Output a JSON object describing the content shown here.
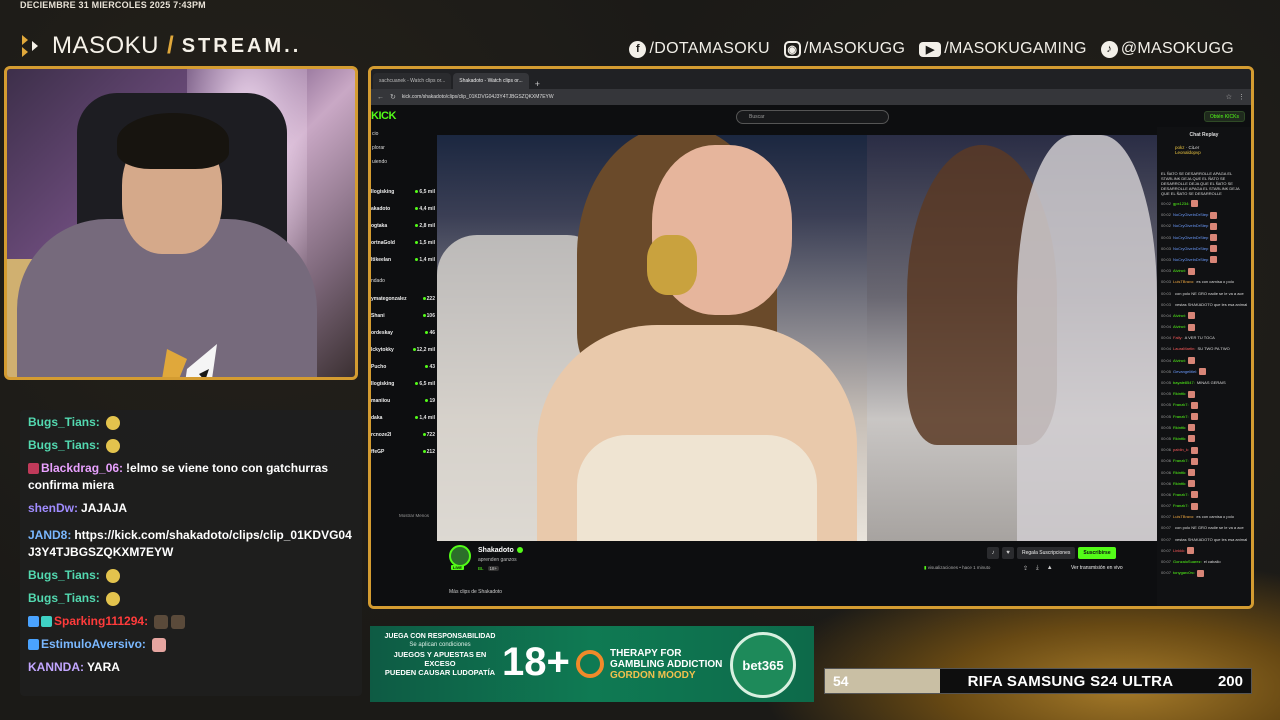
{
  "overlay": {
    "datetime": "DECIEMBRE 31 MIERCOLES 2025 7:43PM",
    "brand_name": "MASOKU",
    "brand_slash": "/",
    "brand_stream": "STREAM..",
    "socials": [
      {
        "icon": "facebook-icon",
        "label": "/DOTAMASOKU"
      },
      {
        "icon": "instagram-icon",
        "label": "/MASOKUGG"
      },
      {
        "icon": "youtube-icon",
        "label": "/MASOKUGAMING"
      },
      {
        "icon": "tiktok-icon",
        "label": "@MASOKUGG"
      }
    ],
    "accent_color": "#d49c31"
  },
  "chat": {
    "messages": [
      {
        "user": "Bugs_Tians:",
        "color": "#53d9b0",
        "text": "",
        "emote": "yellow"
      },
      {
        "user": "Bugs_Tians:",
        "color": "#53d9b0",
        "text": "",
        "emote": "yellow"
      },
      {
        "user": "Blackdrag_06:",
        "color": "#e9a1ff",
        "text": "!elmo se viene tono con gatchurras confirma miera",
        "emote": ""
      },
      {
        "user": "shenDw:",
        "color": "#a08cff",
        "text": "JAJAJA",
        "emote": ""
      },
      {
        "user": "JAND8:",
        "color": "#7ab8ff",
        "text": "https://kick.com/shakadoto/clips/clip_01KDVG04J3Y4TJBGSZQKXM7EYW",
        "emote": ""
      },
      {
        "user": "Bugs_Tians:",
        "color": "#53d9b0",
        "text": "",
        "emote": "yellow"
      },
      {
        "user": "Bugs_Tians:",
        "color": "#53d9b0",
        "text": "",
        "emote": "yellow"
      },
      {
        "user": "Sparking111294:",
        "color": "#ff3b3b",
        "text": "",
        "emote": "dark"
      },
      {
        "user": "EstimuloAversivo:",
        "color": "#7ab8ff",
        "text": "",
        "emote": "pig"
      },
      {
        "user": "KANNDA:",
        "color": "#c2a6ff",
        "text": "YARA",
        "emote": ""
      }
    ]
  },
  "browser": {
    "tabs": [
      "sachcuanek - Watch clips or...",
      "Shakadoto - Watch clips or..."
    ],
    "url": "kick.com/shakadoto/clips/clip_01KDVG04J3Y4TJBGSZQKXM7EYW",
    "kick": {
      "logo": "KICK",
      "search_placeholder": "Buscar",
      "get_kick_button": "Obtén KICKs",
      "sidebar_nav": [
        "cio",
        "plorar",
        "uiendo"
      ],
      "section1": "",
      "channels1": [
        {
          "name": "Ilogisking",
          "sub": "onversando",
          "viewers": "6,5 mil"
        },
        {
          "name": "akadoto",
          "sub": "",
          "viewers": "4,4 mil"
        },
        {
          "name": "ogtaka",
          "sub": "e Z",
          "viewers": "2,8 mil"
        },
        {
          "name": "ortnaGold",
          "sub": "e Z",
          "viewers": "1,5 mil"
        },
        {
          "name": "ltikeelan",
          "sub": "onversando",
          "viewers": "1,4 mil"
        }
      ],
      "section2": "ndado",
      "channels2": [
        {
          "name": "ymategonzalez",
          "sub": "onversando",
          "viewers": "222"
        },
        {
          "name": "Shani",
          "sub": "e Z",
          "viewers": "106"
        },
        {
          "name": "ordeskay",
          "sub": "e Z",
          "viewers": "46"
        },
        {
          "name": "lckytokky",
          "sub": "e Z",
          "viewers": "12,2 mil"
        },
        {
          "name": "Pucho",
          "sub": "& Casino",
          "viewers": "43"
        },
        {
          "name": "Ilogisking",
          "sub": "onversando",
          "viewers": "6,5 mil"
        },
        {
          "name": "maniiou",
          "sub": "Evolution Socc...",
          "viewers": "19"
        },
        {
          "name": "daka",
          "sub": "e Z",
          "viewers": "1,4 mil"
        },
        {
          "name": "rcnoze2l",
          "sub": "onversando",
          "viewers": "722"
        },
        {
          "name": "ffeGP",
          "sub": "",
          "viewers": "212"
        }
      ],
      "show_more": "Mostrar Menos",
      "streamer": {
        "name": "Shakadoto",
        "title": "aprenden ganzos",
        "tag": "BL",
        "tag2": "18+",
        "live": "LIVE",
        "gift_label": "Regala Suscripciones",
        "subscribe_label": "Suscribirse",
        "stats": "visualizaciones • hace 1 minuto",
        "watch_label": "Ver transmisión en vivo",
        "more_clips": "Más clips de Shakadoto"
      },
      "chat_replay": {
        "title": "Chat Replay",
        "pinned_user": "pokz",
        "pinned_user2": "CiLer",
        "pinned_user3": "Leonaldopvp",
        "pinned_text": "EL ÑATO SE DESARROLLE APAGA EL STARLINK DEJA QUE EL ÑATO SE DESARROLLE DEJA QUE EL ÑATO SE DESARROLLE APAGA EL STARLINK DEJA QUE EL ÑATO SE DESARROLLE",
        "lines": [
          {
            "t": "00:02",
            "u": "gpx1234:",
            "c": "",
            "msg": ""
          },
          {
            "t": "00:02",
            "u": "NoCryGiveInDrStep",
            "c": "b",
            "msg": ""
          },
          {
            "t": "00:02",
            "u": "NoCryGiveInDrStep",
            "c": "b",
            "msg": ""
          },
          {
            "t": "00:03",
            "u": "NoCryGiveInDrStep",
            "c": "b",
            "msg": ""
          },
          {
            "t": "00:03",
            "u": "NoCryGiveInDrStep",
            "c": "b",
            "msg": ""
          },
          {
            "t": "00:03",
            "u": "NoCryGiveInDrStep",
            "c": "b",
            "msg": ""
          },
          {
            "t": "00:03",
            "u": "Alvinct:",
            "c": "",
            "msg": ""
          },
          {
            "t": "00:03",
            "u": "LuisTBravo:",
            "c": "o",
            "msg": "es con camisa o polo"
          },
          {
            "t": "00:03",
            "u": "",
            "c": "",
            "msg": "con polo NE GRO nadie se le va a ace"
          },
          {
            "t": "00:03",
            "u": "",
            "c": "",
            "msg": "vestas SHAKADOTO que les esa animal"
          },
          {
            "t": "00:04",
            "u": "Alvinct:",
            "c": "",
            "msg": ""
          },
          {
            "t": "00:04",
            "u": "Alvinct:",
            "c": "",
            "msg": ""
          },
          {
            "t": "00:04",
            "u": "Fally:",
            "c": "r",
            "msg": "A VER TU TOCA"
          },
          {
            "t": "00:04",
            "u": "LauraMartin:",
            "c": "r",
            "msg": "SU TWO PA TWO"
          },
          {
            "t": "00:04",
            "u": "Alvinct:",
            "c": "",
            "msg": ""
          },
          {
            "t": "00:05",
            "u": "Gevangelitlel:",
            "c": "b",
            "msg": ""
          },
          {
            "t": "00:05",
            "u": "bayale8547:",
            "c": "",
            "msg": "MINAS GERAIS"
          },
          {
            "t": "00:05",
            "u": "Rkinttk:",
            "c": "",
            "msg": ""
          },
          {
            "t": "00:05",
            "u": "Franzk7:",
            "c": "",
            "msg": ""
          },
          {
            "t": "00:05",
            "u": "Franzk7:",
            "c": "",
            "msg": ""
          },
          {
            "t": "00:05",
            "u": "Rkinttk:",
            "c": "",
            "msg": ""
          },
          {
            "t": "00:05",
            "u": "Rkinttk:",
            "c": "",
            "msg": ""
          },
          {
            "t": "00:06",
            "u": "pablin_k:",
            "c": "r",
            "msg": ""
          },
          {
            "t": "00:06",
            "u": "Franzk7:",
            "c": "",
            "msg": ""
          },
          {
            "t": "00:06",
            "u": "Rkinttk:",
            "c": "",
            "msg": ""
          },
          {
            "t": "00:06",
            "u": "Rkinttk:",
            "c": "",
            "msg": ""
          },
          {
            "t": "00:06",
            "u": "Franzk7:",
            "c": "",
            "msg": ""
          },
          {
            "t": "00:07",
            "u": "Franzk7:",
            "c": "",
            "msg": ""
          },
          {
            "t": "00:07",
            "u": "LuisTBravo:",
            "c": "o",
            "msg": "es con camisa o polo"
          },
          {
            "t": "00:07",
            "u": "",
            "c": "",
            "msg": "con polo NE GRO nadie se le va a ace"
          },
          {
            "t": "00:07",
            "u": "",
            "c": "",
            "msg": "vestas SHAKADOTO que les esa animal"
          },
          {
            "t": "00:07",
            "u": "Linkkk:",
            "c": "r",
            "msg": ""
          },
          {
            "t": "00:07",
            "u": "GonzaloSuarez:",
            "c": "",
            "msg": "el caballo"
          },
          {
            "t": "00:07",
            "u": "tonygarc0rc:",
            "c": "",
            "msg": ""
          }
        ]
      }
    }
  },
  "ad": {
    "line1": "JUEGA CON RESPONSABILIDAD",
    "line2": "Se aplican condiciones",
    "line3": "JUEGOS Y APUESTAS EN EXCESO",
    "line4": "PUEDEN CAUSAR LUDOPATÍA",
    "age": "18+",
    "therapy1": "THERAPY FOR",
    "therapy2": "GAMBLING ADDICTION",
    "therapy3": "GORDON MOODY",
    "brand": "bet365"
  },
  "raffle": {
    "left_value": "54",
    "title": "RIFA SAMSUNG S24 ULTRA",
    "right_value": "200",
    "progress_fraction": 0.27
  }
}
